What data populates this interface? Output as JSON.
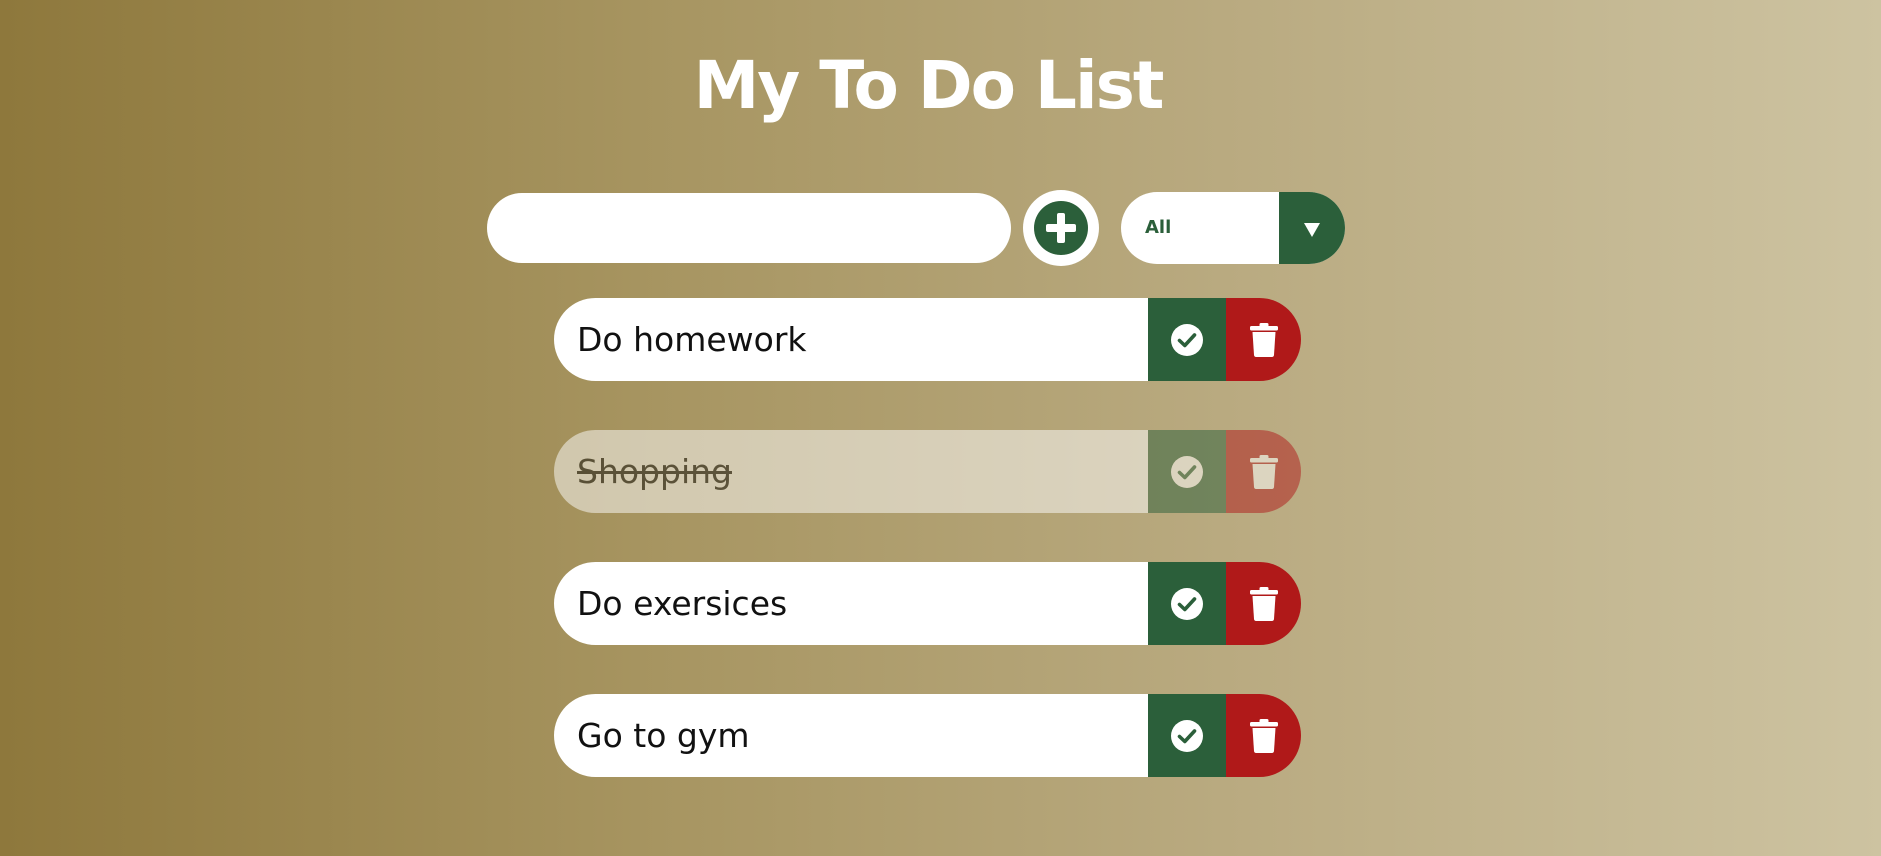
{
  "header": {
    "title": "My To Do List"
  },
  "form": {
    "input_value": "",
    "input_placeholder": "",
    "add_icon": "plus-circle-icon",
    "filter_selected": "All",
    "filter_arrow_icon": "caret-down-icon"
  },
  "todos": [
    {
      "text": "Do homework",
      "completed": false
    },
    {
      "text": "Shopping",
      "completed": true
    },
    {
      "text": "Do exersices",
      "completed": false
    },
    {
      "text": "Go to gym",
      "completed": false
    }
  ],
  "icons": {
    "complete": "check-circle-icon",
    "delete": "trash-icon"
  },
  "colors": {
    "accent_green": "#2b5f3a",
    "delete_red": "#b01919",
    "title_white": "#ffffff",
    "background_start": "#8e783c",
    "background_end": "#cdc3a1"
  }
}
